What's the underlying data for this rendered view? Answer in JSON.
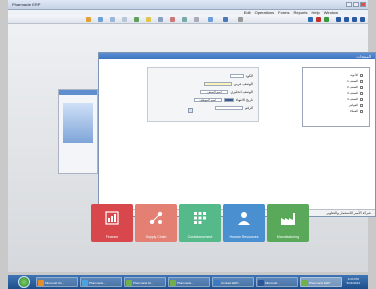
{
  "app": {
    "title": "Pharmacle ERP",
    "menus": [
      "Edit",
      "Operations",
      "Forms",
      "Reports",
      "Help",
      "Window"
    ]
  },
  "form": {
    "title": "المنتجات",
    "fields": [
      {
        "label": "الكود",
        "value": ""
      },
      {
        "label": "الوصف عربي",
        "value": ""
      },
      {
        "label": "الوصف انجليزي",
        "value": "اسم الصنف"
      },
      {
        "label": "تاريخ الانتهاء",
        "value": "اسم الموظف"
      },
      {
        "label": "الرقم",
        "value": ""
      }
    ],
    "tree_items": [
      "الأدوية",
      "الصنف 1",
      "الصنف 2",
      "الصنف 3",
      "الصنف 4",
      "الفواتير",
      "العملاء"
    ],
    "status": {
      "left": "ديسمبر 2014/05/14",
      "mid1": "2014",
      "mid2": "دفتر اليومية",
      "right": "شركة الأمير للاستثمار والتطوير"
    }
  },
  "modules": [
    {
      "label": "Finance",
      "color": "#d8474b",
      "icon": "finance-chart-icon"
    },
    {
      "label": "Supply Chain",
      "color": "#e47f73",
      "icon": "supply-chain-icon"
    },
    {
      "label": "Contabanzment",
      "color": "#56b98a",
      "icon": "grid-apps-icon"
    },
    {
      "label": "Human Resources",
      "color": "#4a8fcf",
      "icon": "person-icon"
    },
    {
      "label": "Manufacturing",
      "color": "#5aa95a",
      "icon": "factory-icon"
    }
  ],
  "taskbar": {
    "items": [
      "Microsoft Ou...",
      "Pharmacle...",
      "Pharmacle M...",
      "Pharmacle...",
      "Contact ERP...",
      "Microsoft...",
      "Pharmacle ERP"
    ],
    "time": "4:24 PM",
    "date": "5/14/2014"
  }
}
